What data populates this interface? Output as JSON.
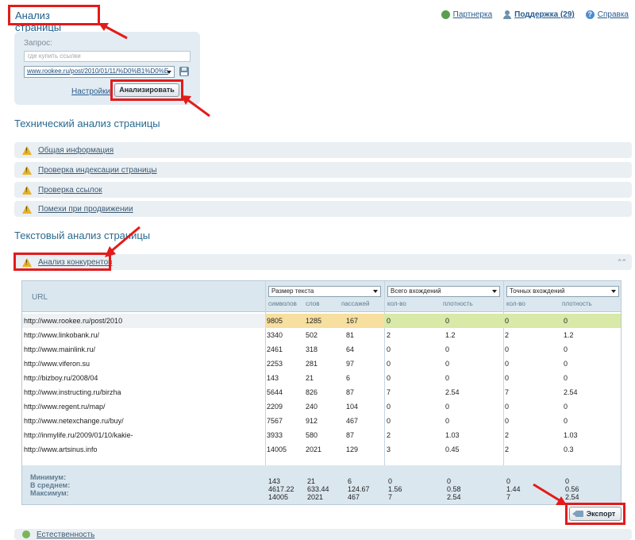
{
  "page": {
    "title": "Анализ страницы"
  },
  "top_links": {
    "partners": "Партнерка",
    "support": "Поддержка (29)",
    "help": "Справка"
  },
  "query": {
    "label": "Запрос:",
    "placeholder": "где купить ссылки",
    "url_value": "www.rookee.ru/post/2010/01/11/%D0%B1%D0%E",
    "settings_link": "Настройки",
    "analyze_button": "Анализировать"
  },
  "technical": {
    "title": "Технический анализ страницы",
    "items": [
      {
        "label": "Общая информация"
      },
      {
        "label": "Проверка индексации страницы"
      },
      {
        "label": "Проверка ссылок"
      },
      {
        "label": "Помехи при продвижении"
      }
    ]
  },
  "textual": {
    "title": "Текстовый анализ страницы",
    "competitors_label": "Анализ конкурентов"
  },
  "competitors_table": {
    "url_header": "URL",
    "group_selects": [
      "Размер текста",
      "Всего вхождений",
      "Точных вхождений"
    ],
    "sub_headers": {
      "size": [
        "символов",
        "слов",
        "пассажей"
      ],
      "total": [
        "кол-во",
        "плотность"
      ],
      "exact": [
        "кол-во",
        "плотность"
      ]
    },
    "rows": [
      {
        "url": "http://www.rookee.ru/post/2010",
        "chars": "9805",
        "words": "1285",
        "passages": "167",
        "total_count": "0",
        "total_density": "0",
        "exact_count": "0",
        "exact_density": "0"
      },
      {
        "url": "http://www.linkobank.ru/",
        "chars": "3340",
        "words": "502",
        "passages": "81",
        "total_count": "2",
        "total_density": "1.2",
        "exact_count": "2",
        "exact_density": "1.2"
      },
      {
        "url": "http://www.mainlink.ru/",
        "chars": "2461",
        "words": "318",
        "passages": "64",
        "total_count": "0",
        "total_density": "0",
        "exact_count": "0",
        "exact_density": "0"
      },
      {
        "url": "http://www.viferon.su",
        "chars": "2253",
        "words": "281",
        "passages": "97",
        "total_count": "0",
        "total_density": "0",
        "exact_count": "0",
        "exact_density": "0"
      },
      {
        "url": "http://bizboy.ru/2008/04",
        "chars": "143",
        "words": "21",
        "passages": "6",
        "total_count": "0",
        "total_density": "0",
        "exact_count": "0",
        "exact_density": "0"
      },
      {
        "url": "http://www.instructing.ru/birzha",
        "chars": "5644",
        "words": "826",
        "passages": "87",
        "total_count": "7",
        "total_density": "2.54",
        "exact_count": "7",
        "exact_density": "2.54"
      },
      {
        "url": "http://www.regent.ru/map/",
        "chars": "2209",
        "words": "240",
        "passages": "104",
        "total_count": "0",
        "total_density": "0",
        "exact_count": "0",
        "exact_density": "0"
      },
      {
        "url": "http://www.netexchange.ru/buy/",
        "chars": "7567",
        "words": "912",
        "passages": "467",
        "total_count": "0",
        "total_density": "0",
        "exact_count": "0",
        "exact_density": "0"
      },
      {
        "url": "http://inmylife.ru/2009/01/10/kakie-",
        "chars": "3933",
        "words": "580",
        "passages": "87",
        "total_count": "2",
        "total_density": "1.03",
        "exact_count": "2",
        "exact_density": "1.03"
      },
      {
        "url": "http://www.artsinus.info",
        "chars": "14005",
        "words": "2021",
        "passages": "129",
        "total_count": "3",
        "total_density": "0.45",
        "exact_count": "2",
        "exact_density": "0.3"
      }
    ],
    "summary_labels": [
      "Минимум:",
      "В среднем:",
      "Максимум:"
    ],
    "summary": {
      "chars": [
        "143",
        "4617.22",
        "14005"
      ],
      "words": [
        "21",
        "633.44",
        "2021"
      ],
      "passages": [
        "6",
        "124.67",
        "467"
      ],
      "total_count": [
        "0",
        "1.56",
        "7"
      ],
      "total_density": [
        "0",
        "0.58",
        "2.54"
      ],
      "exact_count": [
        "0",
        "1.44",
        "7"
      ],
      "exact_density": [
        "0",
        "0.56",
        "2.54"
      ]
    }
  },
  "export_button": "Экспорт",
  "bottom_item": "Естественность",
  "colors": {
    "highlight_red": "#e31b1b",
    "title_blue": "#1f5e8a",
    "panel_bg": "#e3ecf2",
    "warning": "#e8b224",
    "row_yellow": "#f6df9f",
    "row_green": "#d8e9a8"
  },
  "icons": [
    "partner-icon",
    "support-user-icon",
    "help-icon",
    "save-disk-icon",
    "warning-icon",
    "collapse-chevrons-icon",
    "export-icon",
    "ok-icon",
    "red-arrow-icon"
  ]
}
